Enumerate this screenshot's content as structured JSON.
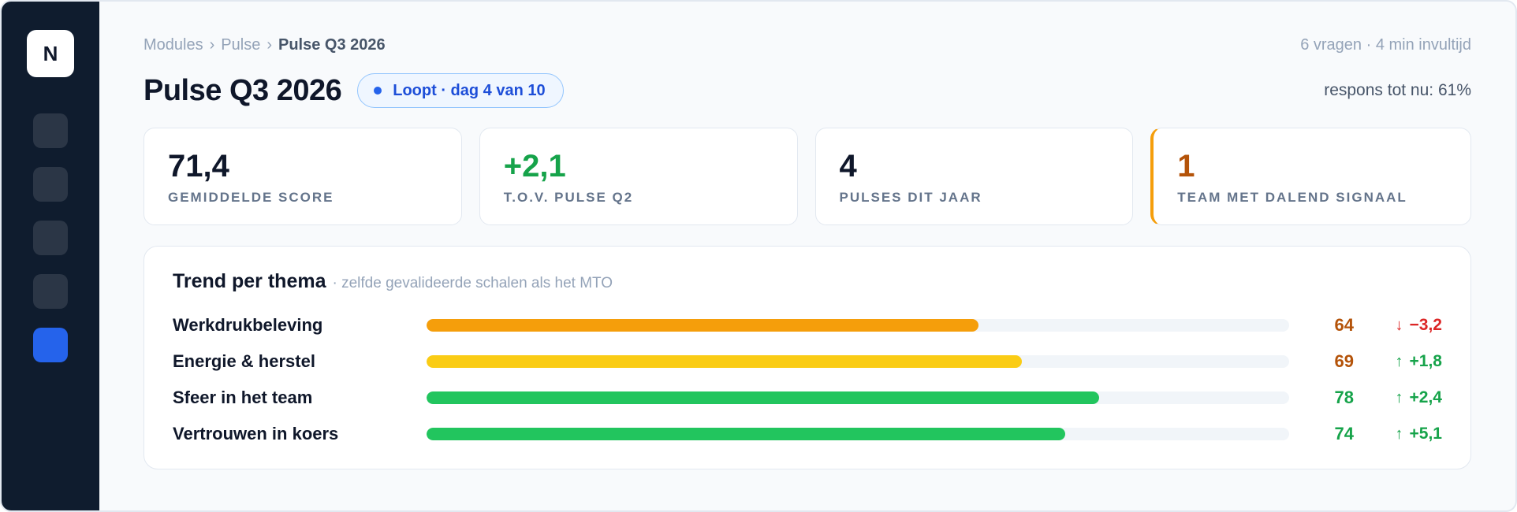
{
  "sidebar": {
    "logo": "N",
    "items": [
      {
        "name": "nav-item-1",
        "active": false
      },
      {
        "name": "nav-item-2",
        "active": false
      },
      {
        "name": "nav-item-3",
        "active": false
      },
      {
        "name": "nav-item-4",
        "active": false
      },
      {
        "name": "nav-item-5",
        "active": true
      }
    ]
  },
  "breadcrumb": {
    "items": [
      "Modules",
      "Pulse"
    ],
    "separator": "›",
    "current": "Pulse Q3 2026"
  },
  "meta": "6 vragen · 4 min invultijd",
  "header": {
    "title": "Pulse Q3 2026",
    "status": "Loopt · dag 4 van 10",
    "response": "respons tot nu: 61%"
  },
  "kpis": [
    {
      "value": "71,4",
      "label": "GEMIDDELDE SCORE",
      "color": "#0f172a",
      "warn": false
    },
    {
      "value": "+2,1",
      "label": "T.O.V. PULSE Q2",
      "color": "#16a34a",
      "warn": false
    },
    {
      "value": "4",
      "label": "PULSES DIT JAAR",
      "color": "#0f172a",
      "warn": false
    },
    {
      "value": "1",
      "label": "TEAM MET DALEND SIGNAAL",
      "color": "#b45309",
      "warn": true
    }
  ],
  "trend": {
    "title": "Trend per thema",
    "subtitle": "· zelfde gevalideerde schalen als het MTO",
    "rows": [
      {
        "label": "Werkdrukbeleving",
        "fill": 0.64,
        "score": "64",
        "delta": "−3,2",
        "direction": "down",
        "bar_color": "#f59e0b",
        "score_color": "#b45309",
        "delta_color": "#dc2626"
      },
      {
        "label": "Energie & herstel",
        "fill": 0.69,
        "score": "69",
        "delta": "+1,8",
        "direction": "up",
        "bar_color": "#facc15",
        "score_color": "#b45309",
        "delta_color": "#16a34a"
      },
      {
        "label": "Sfeer in het team",
        "fill": 0.78,
        "score": "78",
        "delta": "+2,4",
        "direction": "up",
        "bar_color": "#22c55e",
        "score_color": "#16a34a",
        "delta_color": "#16a34a"
      },
      {
        "label": "Vertrouwen in koers",
        "fill": 0.74,
        "score": "74",
        "delta": "+5,1",
        "direction": "up",
        "bar_color": "#22c55e",
        "score_color": "#16a34a",
        "delta_color": "#16a34a"
      }
    ]
  }
}
